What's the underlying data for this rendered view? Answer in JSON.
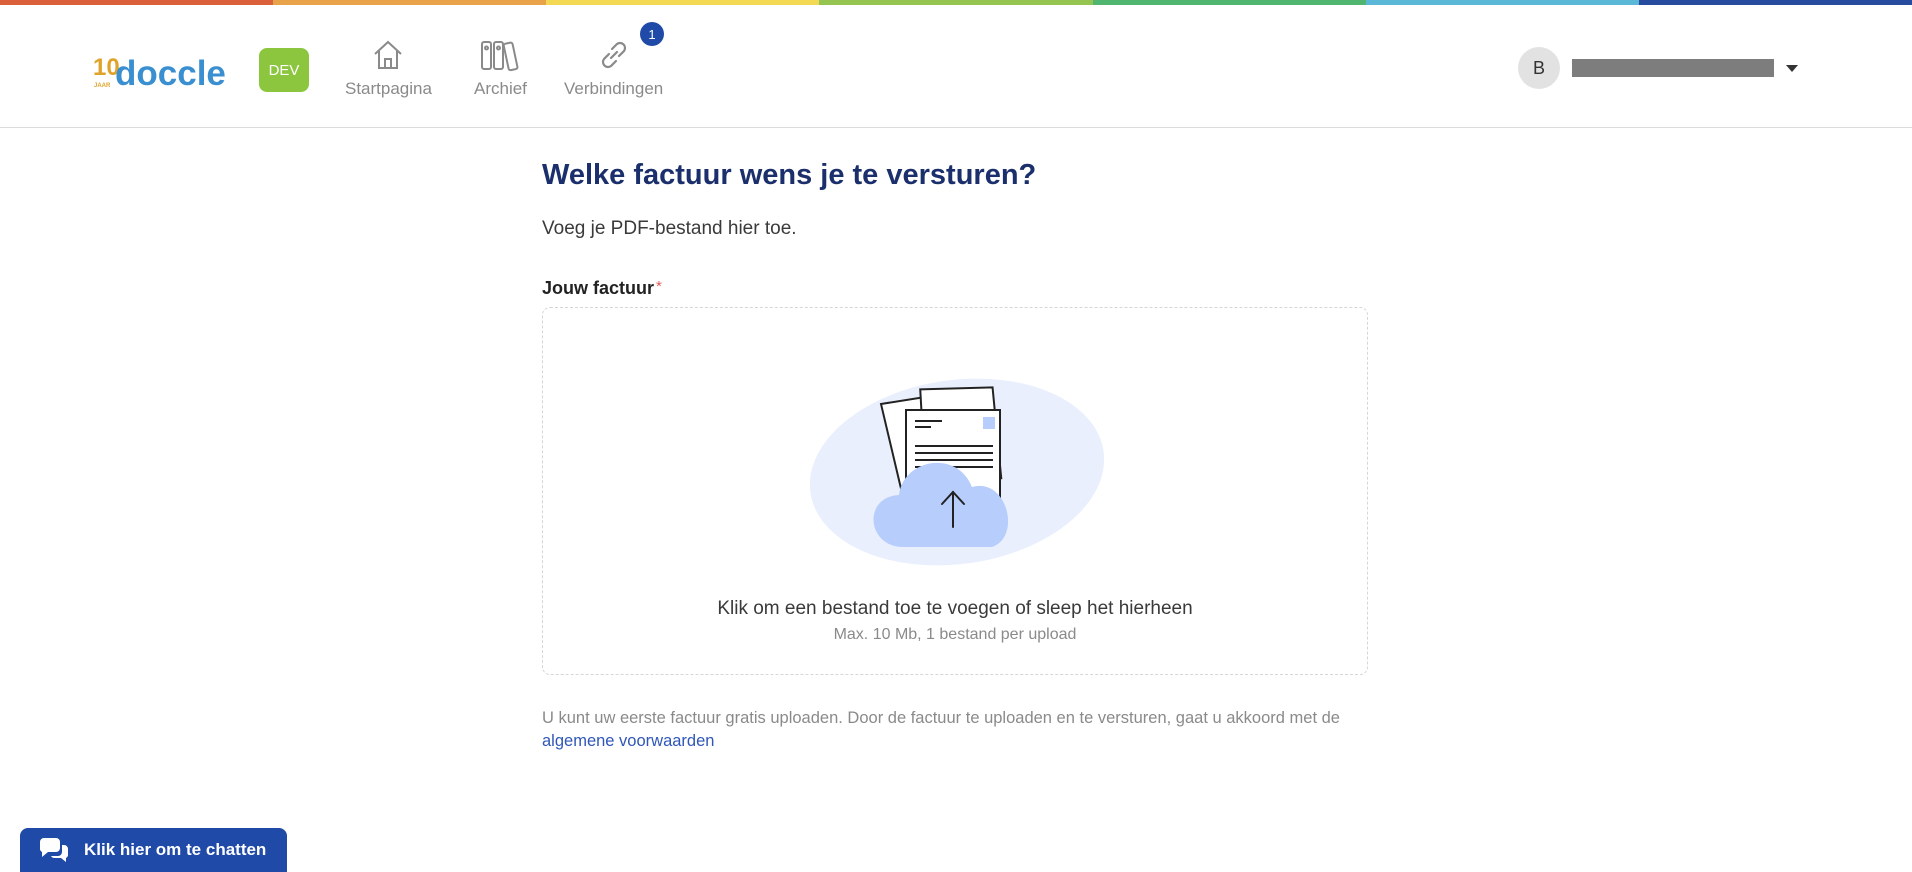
{
  "colors": {
    "rainbow": [
      "#d9603b",
      "#e8a24a",
      "#f3d854",
      "#95c450",
      "#4fb56f",
      "#5bb7d6",
      "#264a9e"
    ],
    "accent": "#1f4aa8",
    "dev_badge": "#8cc63f",
    "heading": "#1a2f6b"
  },
  "header": {
    "logo": {
      "years_text": "10",
      "years_sub": "JAAR",
      "brand": "doccle"
    },
    "env_badge": "DEV",
    "nav": [
      {
        "label": "Startpagina",
        "icon": "home-icon"
      },
      {
        "label": "Archief",
        "icon": "archive-icon"
      },
      {
        "label": "Verbindingen",
        "icon": "link-icon",
        "badge": "1"
      }
    ],
    "user": {
      "initial": "B",
      "icon": "chevron-down-icon"
    }
  },
  "main": {
    "title": "Welke factuur wens je te versturen?",
    "intro": "Voeg je PDF-bestand hier toe.",
    "field_label": "Jouw factuur",
    "required_marker": "*",
    "dropzone": {
      "title": "Klik om een bestand toe te voegen of sleep het hierheen",
      "subtitle": "Max. 10 Mb, 1 bestand per upload",
      "icon": "cloud-upload-illustration"
    },
    "disclaimer_text": "U kunt uw eerste factuur gratis uploaden. Door de factuur te uploaden en te versturen, gaat u akkoord met de ",
    "disclaimer_link": "algemene voorwaarden"
  },
  "chat": {
    "label": "Klik hier om te chatten",
    "icon": "chat-icon"
  }
}
